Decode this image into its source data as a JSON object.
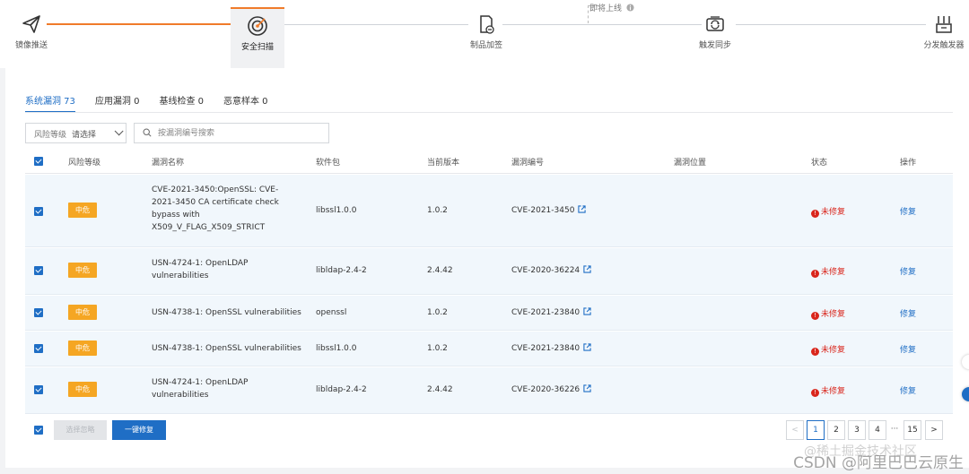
{
  "pipeline": {
    "soon_label": "即将上线",
    "steps": [
      {
        "label": "镜像推送",
        "icon": "send-icon"
      },
      {
        "label": "安全扫描",
        "icon": "scan-target-icon",
        "active": true
      },
      {
        "label": "制品加签",
        "icon": "sign-document-icon"
      },
      {
        "label": "触发同步",
        "icon": "sync-trigger-icon"
      },
      {
        "label": "分发触发器",
        "icon": "distribute-trigger-icon"
      }
    ]
  },
  "tabs": [
    {
      "label": "系统漏洞 73",
      "active": true
    },
    {
      "label": "应用漏洞 0"
    },
    {
      "label": "基线检查 0"
    },
    {
      "label": "恶意样本 0"
    }
  ],
  "filters": {
    "risk_label": "风险等级",
    "risk_placeholder": "请选择",
    "search_placeholder": "按漏洞编号搜索"
  },
  "table": {
    "columns": [
      "风险等级",
      "漏洞名称",
      "软件包",
      "当前版本",
      "漏洞编号",
      "漏洞位置",
      "状态",
      "操作"
    ],
    "rows": [
      {
        "risk": "中危",
        "name": "CVE-2021-3450:OpenSSL: CVE-2021-3450 CA certificate check bypass with X509_V_FLAG_X509_STRICT",
        "package": "libssl1.0.0",
        "version": "1.0.2",
        "cve": "CVE-2021-3450",
        "location": "",
        "status": "未修复",
        "action": "修复"
      },
      {
        "risk": "中危",
        "name": "USN-4724-1: OpenLDAP vulnerabilities",
        "package": "libldap-2.4-2",
        "version": "2.4.42",
        "cve": "CVE-2020-36224",
        "location": "",
        "status": "未修复",
        "action": "修复"
      },
      {
        "risk": "中危",
        "name": "USN-4738-1: OpenSSL vulnerabilities",
        "package": "openssl",
        "version": "1.0.2",
        "cve": "CVE-2021-23840",
        "location": "",
        "status": "未修复",
        "action": "修复"
      },
      {
        "risk": "中危",
        "name": "USN-4738-1: OpenSSL vulnerabilities",
        "package": "libssl1.0.0",
        "version": "1.0.2",
        "cve": "CVE-2021-23840",
        "location": "",
        "status": "未修复",
        "action": "修复"
      },
      {
        "risk": "中危",
        "name": "USN-4724-1: OpenLDAP vulnerabilities",
        "package": "libldap-2.4-2",
        "version": "2.4.42",
        "cve": "CVE-2020-36226",
        "location": "",
        "status": "未修复",
        "action": "修复"
      }
    ]
  },
  "footer": {
    "ignore_label": "选择忽略",
    "fix_all_label": "一键修复"
  },
  "pagination": {
    "prev": "<",
    "next": ">",
    "pages": [
      "1",
      "2",
      "3",
      "4"
    ],
    "ellipsis": "···",
    "last": "15",
    "current": "1"
  },
  "watermark": {
    "line1": "@稀土掘金技术社区",
    "line2": "CSDN @阿里巴巴云原生"
  },
  "colors": {
    "accent": "#1f6ec5",
    "progress": "#f07b2a",
    "severity_medium": "#f5a623",
    "status_unfixed": "#d9261c"
  }
}
